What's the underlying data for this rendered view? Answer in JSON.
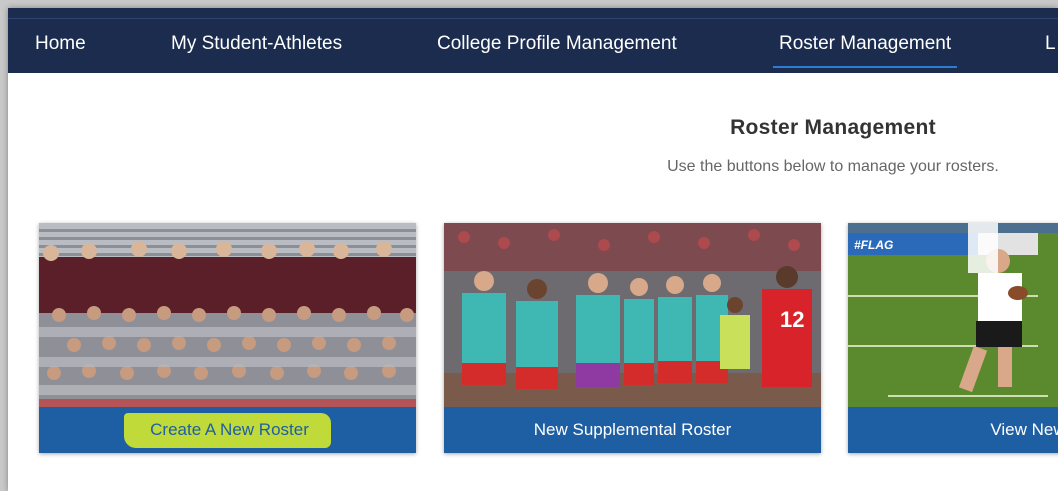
{
  "nav": {
    "items": [
      {
        "label": "Home",
        "active": false
      },
      {
        "label": "My Student-Athletes",
        "active": false
      },
      {
        "label": "College Profile Management",
        "active": false
      },
      {
        "label": "Roster Management",
        "active": true
      },
      {
        "label": "L",
        "active": false
      }
    ]
  },
  "page": {
    "title": "Roster Management",
    "subtitle": "Use the buttons below to manage your rosters."
  },
  "cards": [
    {
      "label": "Create A New Roster",
      "highlighted": true,
      "photo": "football team photo"
    },
    {
      "label": "New Supplemental Roster",
      "highlighted": false,
      "photo": "women's soccer team celebrating"
    },
    {
      "label": "View New R",
      "highlighted": false,
      "photo": "flag football player running"
    }
  ],
  "colors": {
    "nav_bg": "#1b2c4e",
    "card_button_bg": "#1e5fa3",
    "active_underline": "#2f7bd2",
    "highlight": "#ddf028"
  }
}
